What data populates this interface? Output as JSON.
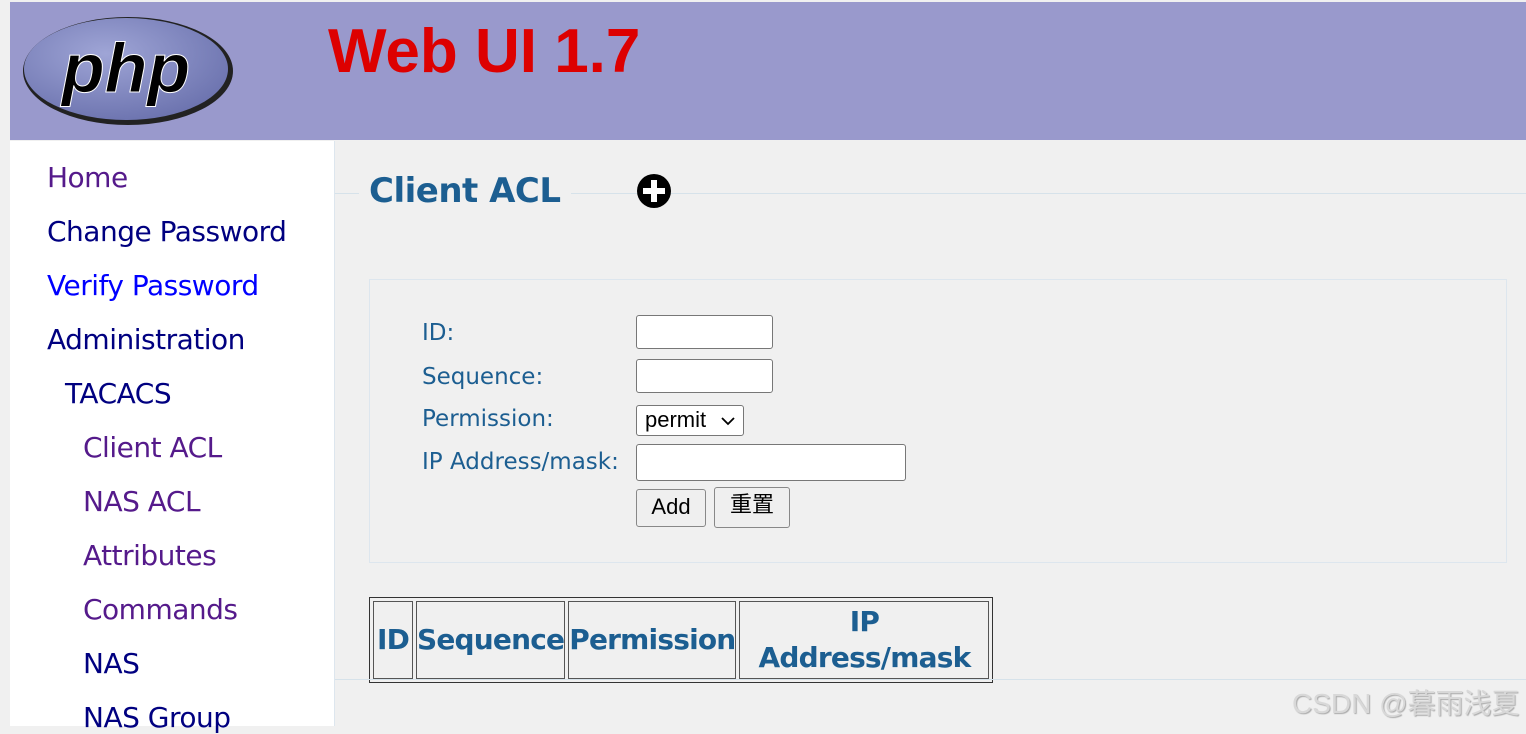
{
  "header": {
    "logo_text": "php",
    "title": "Web UI 1.7",
    "bg": "#9999cc",
    "title_color": "#dd0000"
  },
  "sidebar": {
    "items": [
      {
        "label": "Home",
        "color": "#551a8b"
      },
      {
        "label": "Change Password",
        "color": "#000080"
      },
      {
        "label": "Verify Password",
        "color": "#0000ff"
      },
      {
        "label": "Administration",
        "color": "#000080"
      },
      {
        "label": "TACACS",
        "color": "#000080"
      },
      {
        "label": "Client ACL",
        "color": "#551a8b"
      },
      {
        "label": "NAS ACL",
        "color": "#551a8b"
      },
      {
        "label": "Attributes",
        "color": "#551a8b"
      },
      {
        "label": "Commands",
        "color": "#551a8b"
      },
      {
        "label": "NAS",
        "color": "#000080"
      },
      {
        "label": "NAS Group",
        "color": "#000080"
      }
    ]
  },
  "main": {
    "title": "Client ACL",
    "add_icon": "plus-circle-icon",
    "form": {
      "id_label": "ID:",
      "id_value": "",
      "sequence_label": "Sequence:",
      "sequence_value": "",
      "permission_label": "Permission:",
      "permission_value": "permit",
      "ip_label": "IP Address/mask:",
      "ip_value": "",
      "add_button": "Add",
      "reset_button": "重置"
    },
    "table": {
      "headers": [
        "ID",
        "Sequence",
        "Permission",
        "IP Address/mask"
      ],
      "rows": []
    }
  },
  "watermark": "CSDN @暮雨浅夏"
}
